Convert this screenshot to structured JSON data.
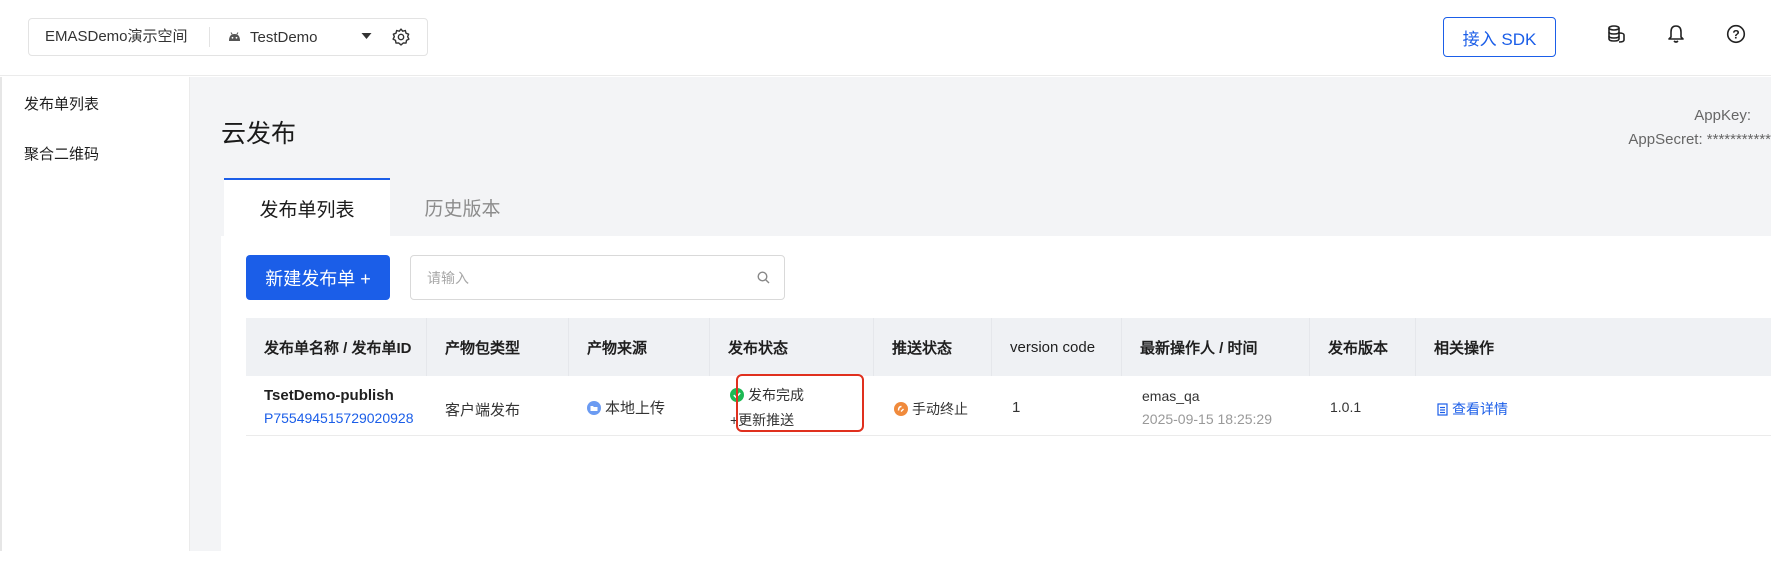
{
  "header": {
    "workspace": "EMASDemo演示空间",
    "app_name": "TestDemo",
    "sdk_button": "接入 SDK",
    "icons": [
      "gear-icon",
      "coins-icon",
      "bell-icon",
      "help-icon"
    ]
  },
  "sidebar": {
    "items": [
      {
        "label": "发布单列表"
      },
      {
        "label": "聚合二维码"
      }
    ]
  },
  "main": {
    "title": "云发布",
    "appkey_label": "AppKey:",
    "appsecret_label": "AppSecret: ***********",
    "tabs": [
      {
        "label": "发布单列表",
        "active": true
      },
      {
        "label": "历史版本",
        "active": false
      }
    ],
    "new_button": "新建发布单 +",
    "search": {
      "placeholder": "请输入",
      "value": ""
    }
  },
  "table": {
    "headers": [
      "发布单名称 / 发布单ID",
      "产物包类型",
      "产物来源",
      "发布状态",
      "推送状态",
      "version code",
      "最新操作人 / 时间",
      "发布版本",
      "相关操作"
    ],
    "rows": [
      {
        "name": "TsetDemo-publish",
        "id": "P755494515729020928",
        "package_type": "客户端发布",
        "source": "本地上传",
        "publish_status": "发布完成",
        "update_push": "+更新推送",
        "push_status": "手动终止",
        "version_code": "1",
        "operator": "emas_qa",
        "time": "2025-09-15 18:25:29",
        "version": "1.0.1",
        "action": "查看详情"
      }
    ]
  },
  "colors": {
    "accent": "#1b5ee8",
    "success": "#1db954",
    "warning": "#f08a3c",
    "highlight": "#e0301e"
  }
}
